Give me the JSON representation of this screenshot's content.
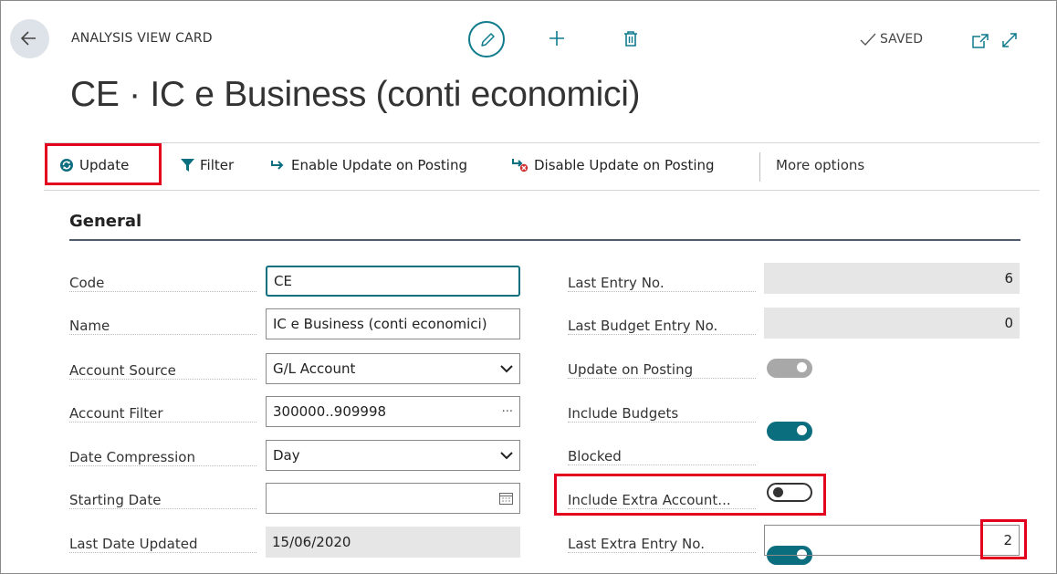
{
  "header": {
    "caption": "ANALYSIS VIEW CARD",
    "saved_status": "SAVED",
    "title": "CE · IC e Business (conti economici)",
    "icons": [
      "back-arrow-icon",
      "edit-pencil-icon",
      "plus-icon",
      "trash-icon",
      "check-icon",
      "popout-icon",
      "expand-icon"
    ]
  },
  "toolbar": {
    "update": "Update",
    "filter": "Filter",
    "enable_update": "Enable Update on Posting",
    "disable_update": "Disable Update on Posting",
    "more_options": "More options"
  },
  "section": {
    "title": "General"
  },
  "left_fields": [
    {
      "label": "Code",
      "value": "CE"
    },
    {
      "label": "Name",
      "value": "IC e Business (conti economici)"
    },
    {
      "label": "Account Source",
      "value": "G/L Account"
    },
    {
      "label": "Account Filter",
      "value": "300000..909998"
    },
    {
      "label": "Date Compression",
      "value": "Day"
    },
    {
      "label": "Starting Date",
      "value": ""
    },
    {
      "label": "Last Date Updated",
      "value": "15/06/2020"
    }
  ],
  "right_fields": [
    {
      "label": "Last Entry No.",
      "value": "6"
    },
    {
      "label": "Last Budget Entry No.",
      "value": "0"
    },
    {
      "label": "Update on Posting",
      "toggle": "on-disabled"
    },
    {
      "label": "Include Budgets",
      "toggle": "on"
    },
    {
      "label": "Blocked",
      "toggle": "off"
    },
    {
      "label": "Include Extra Account...",
      "toggle": "on"
    },
    {
      "label": "Last Extra Entry No.",
      "value": "2"
    }
  ],
  "colors": {
    "accent": "#0b6e7f",
    "highlight": "#e3001f",
    "readonly_bg": "#e6e6e6"
  }
}
